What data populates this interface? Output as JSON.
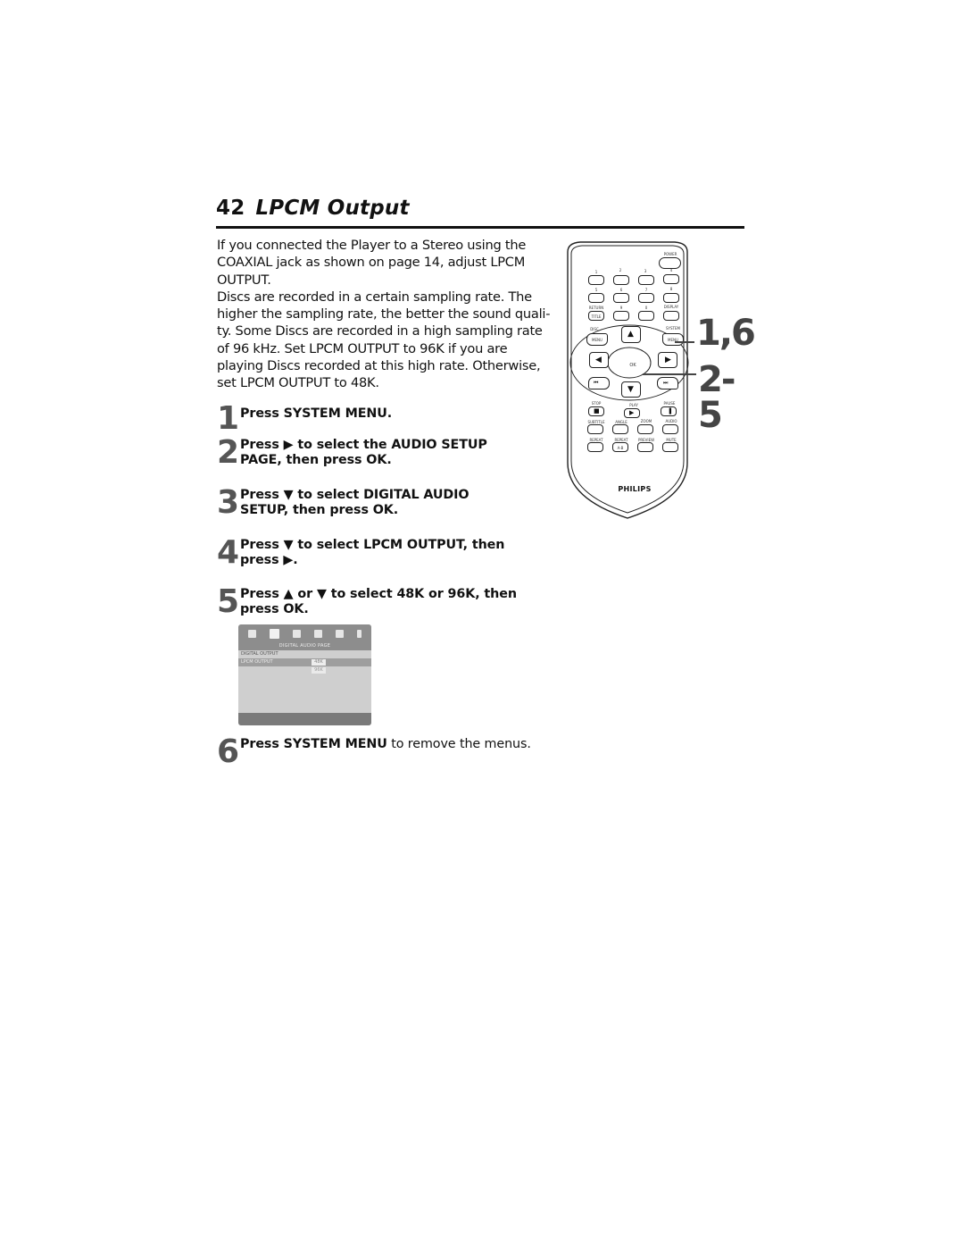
{
  "page": {
    "number": "42",
    "title": "LPCM Output"
  },
  "intro": {
    "paragraph1": "If you connected the Player to a Stereo using the COAXIAL jack as shown on page 14, adjust LPCM OUTPUT.",
    "paragraph2": "Discs are recorded in a certain sampling rate.  The higher the sampling rate, the better the sound quali-ty.  Some Discs are recorded in a high sampling rate of 96 kHz.  Set LPCM OUTPUT to 96K if you are playing Discs recorded at this high rate. Otherwise, set LPCM OUTPUT to 48K."
  },
  "steps": [
    {
      "number": "1",
      "line1": "Press SYSTEM MENU.",
      "line2": ""
    },
    {
      "number": "2",
      "line1": "Press ▶ to select the AUDIO SETUP",
      "line2": "PAGE, then press OK."
    },
    {
      "number": "3",
      "line1": "Press ▼ to select DIGITAL AUDIO",
      "line2": "SETUP, then press OK."
    },
    {
      "number": "4",
      "line1": "Press ▼ to select LPCM OUTPUT, then",
      "line2": "press ▶."
    },
    {
      "number": "5",
      "line1": "Press ▲ or ▼ to select 48K or 96K, then",
      "line2": "press OK."
    },
    {
      "number": "6",
      "bold": "Press SYSTEM MENU",
      "rest": " to remove the menus."
    }
  ],
  "osd": {
    "page_title": "DIGITAL AUDIO PAGE",
    "rows": [
      {
        "label": "DIGITAL OUTPUT",
        "value": ""
      },
      {
        "label": "LPCM OUTPUT",
        "value": "48K"
      },
      {
        "label": "",
        "value": "96K"
      }
    ],
    "icons": [
      "general-setup-icon",
      "audio-setup-icon",
      "video-setup-icon",
      "preference-icon",
      "password-icon",
      "exit-icon"
    ]
  },
  "remote": {
    "brand": "PHILIPS",
    "power": "POWER",
    "number_labels": [
      "1",
      "2",
      "3",
      "4",
      "5",
      "6",
      "7",
      "8"
    ],
    "row3_labels": [
      "RETURN",
      "9",
      "0",
      "DISPLAY"
    ],
    "return_sub": "TITLE",
    "disc_menu": [
      "DISC",
      "MENU"
    ],
    "system_menu": [
      "SYSTEM",
      "MENU"
    ],
    "ok": "OK",
    "transport_labels": [
      "STOP",
      "PLAY",
      "PAUSE"
    ],
    "func_row1": [
      "SUBTITLE",
      "ANGLE",
      "ZOOM",
      "AUDIO"
    ],
    "func_row2": [
      "REPEAT",
      "REPEAT",
      "PREVIEW",
      "MUTE"
    ],
    "repeat_sub": "A-B",
    "callouts": [
      "1,6",
      "2-5"
    ]
  }
}
